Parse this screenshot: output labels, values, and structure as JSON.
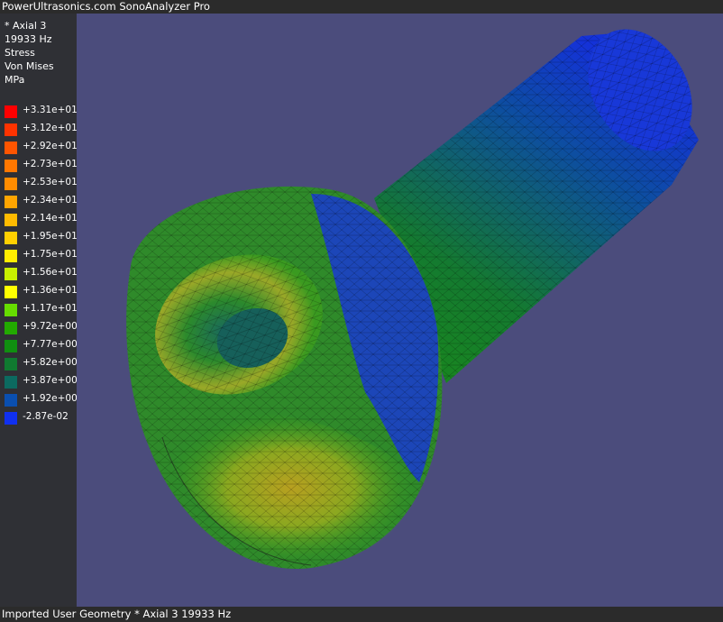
{
  "window": {
    "title": "PowerUltrasonics.com SonoAnalyzer Pro"
  },
  "result_info": {
    "mode": "* Axial 3",
    "frequency": "19933 Hz",
    "quantity": "Stress",
    "component": "Von Mises",
    "unit": "MPa"
  },
  "legend": [
    {
      "label": "+3.31e+01",
      "color": "#ff0000"
    },
    {
      "label": "+3.12e+01",
      "color": "#ff3300"
    },
    {
      "label": "+2.92e+01",
      "color": "#ff5500"
    },
    {
      "label": "+2.73e+01",
      "color": "#ff7700"
    },
    {
      "label": "+2.53e+01",
      "color": "#ff8c00"
    },
    {
      "label": "+2.34e+01",
      "color": "#ffa500"
    },
    {
      "label": "+2.14e+01",
      "color": "#ffbb00"
    },
    {
      "label": "+1.95e+01",
      "color": "#ffd000"
    },
    {
      "label": "+1.75e+01",
      "color": "#ffee00"
    },
    {
      "label": "+1.56e+01",
      "color": "#c8f000"
    },
    {
      "label": "+1.36e+01",
      "color": "#ffff00"
    },
    {
      "label": "+1.17e+01",
      "color": "#66dd00"
    },
    {
      "label": "+9.72e+00",
      "color": "#22aa00"
    },
    {
      "label": "+7.77e+00",
      "color": "#108f10"
    },
    {
      "label": "+5.82e+00",
      "color": "#107a30"
    },
    {
      "label": "+3.87e+00",
      "color": "#0c6a60"
    },
    {
      "label": "+1.92e+00",
      "color": "#0a4fb0"
    },
    {
      "label": "-2.87e-02",
      "color": "#1030f0"
    }
  ],
  "status": {
    "text": "Imported User Geometry * Axial 3 19933 Hz"
  }
}
